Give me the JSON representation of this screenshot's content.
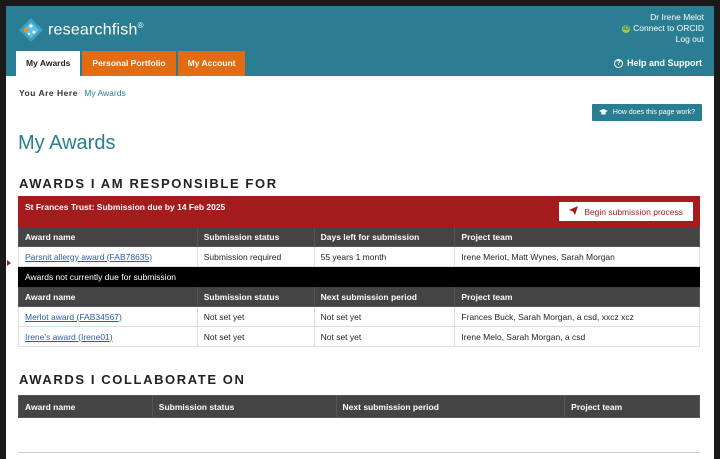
{
  "header": {
    "logo_text": "researchfish",
    "logo_mark": "®",
    "user_name": "Dr Irene Melot",
    "orcid_label": "Connect to ORCID",
    "orcid_badge": "iD",
    "logout_label": "Log out",
    "help_label": "Help and Support",
    "help_glyph": "?",
    "tabs": [
      {
        "label": "My Awards",
        "active": true
      },
      {
        "label": "Personal Portfolio",
        "active": false
      },
      {
        "label": "My Account",
        "active": false
      }
    ]
  },
  "breadcrumb": {
    "prefix": "You Are Here",
    "current": "My Awards"
  },
  "how_button": "How does this page work?",
  "page_title": "My Awards",
  "responsible": {
    "section_title": "AWARDS I AM RESPONSIBLE FOR",
    "due_banner": "St Frances Trust: Submission due by 14 Feb 2025",
    "begin_label": "Begin submission process",
    "due_headers": [
      "Award name",
      "Submission status",
      "Days left for submission",
      "Project team"
    ],
    "due_rows": [
      {
        "award": "Parsnit allergy award (FAB78635)",
        "status": "Submission required",
        "days": "55 years 1 month",
        "team": "Irene Meriot, Matt Wynes, Sarah Morgan"
      }
    ],
    "not_due_banner": "Awards not currently due for submission",
    "not_due_headers": [
      "Award name",
      "Submission status",
      "Next submission period",
      "Project team"
    ],
    "not_due_rows": [
      {
        "award": "Merlot award (FAB34567)",
        "status": "Not set yet",
        "period": "Not set yet",
        "team": "Frances Buck, Sarah Morgan, a csd, xxcz xcz"
      },
      {
        "award": "Irene's award (Irene01)",
        "status": "Not set yet",
        "period": "Not set yet",
        "team": "Irene Melo, Sarah Morgan, a csd"
      }
    ]
  },
  "collaborate": {
    "section_title": "AWARDS I COLLABORATE ON",
    "headers": [
      "Award name",
      "Submission status",
      "Next submission period",
      "Project team"
    ]
  },
  "colors": {
    "header_teal": "#2a7d92",
    "tab_orange": "#e36b12",
    "banner_red": "#a51c1f"
  }
}
